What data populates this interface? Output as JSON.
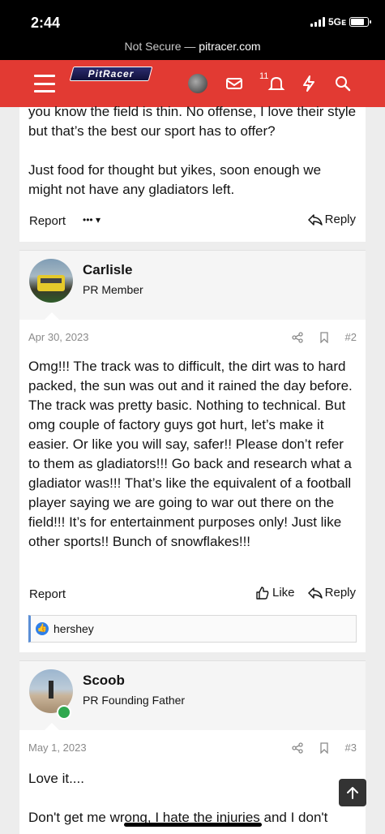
{
  "status": {
    "time": "2:44",
    "network": "5Gᴇ"
  },
  "browser": {
    "security": "Not Secure",
    "separator": " — ",
    "domain": "pitracer.com"
  },
  "header": {
    "logo_text": "PitRacer",
    "notification_count": "11"
  },
  "post1": {
    "lines": [
      "you know the field is thin. No offense, I love their style but that’s the best our sport has to offer?",
      "Just food for thought but yikes, soon enough we might not have any gladiators left."
    ],
    "report": "Report",
    "more": "••• ▾",
    "reply": "Reply"
  },
  "post2": {
    "username": "Carlisle",
    "user_title": "PR Member",
    "date": "Apr 30, 2023",
    "number": "#2",
    "text": "Omg!!! The track was to difficult, the dirt was to hard packed, the sun was out and it rained the day before. The track was pretty basic. Nothing to technical. But omg couple of factory guys got hurt, let’s make it easier. Or like you will say, safer!! Please don’t refer to them as gladiators!!! Go back and research what a gladiator was!!! That’s like the equivalent of a football player saying we are going to war out there on the field!!! It’s for entertainment purposes only! Just like other sports!! Bunch of snowflakes!!!",
    "report": "Report",
    "like": "Like",
    "reply": "Reply",
    "reaction_user": "hershey"
  },
  "post3": {
    "username": "Scoob",
    "user_title": "PR Founding Father",
    "date": "May 1, 2023",
    "number": "#3",
    "line1": "Love it....",
    "line2": "Don't get me wrong, I hate the injuries and I don't"
  },
  "colors": {
    "brand_red": "#e23a33",
    "like_blue": "#2e7fe8",
    "online_green": "#2fa84f"
  }
}
